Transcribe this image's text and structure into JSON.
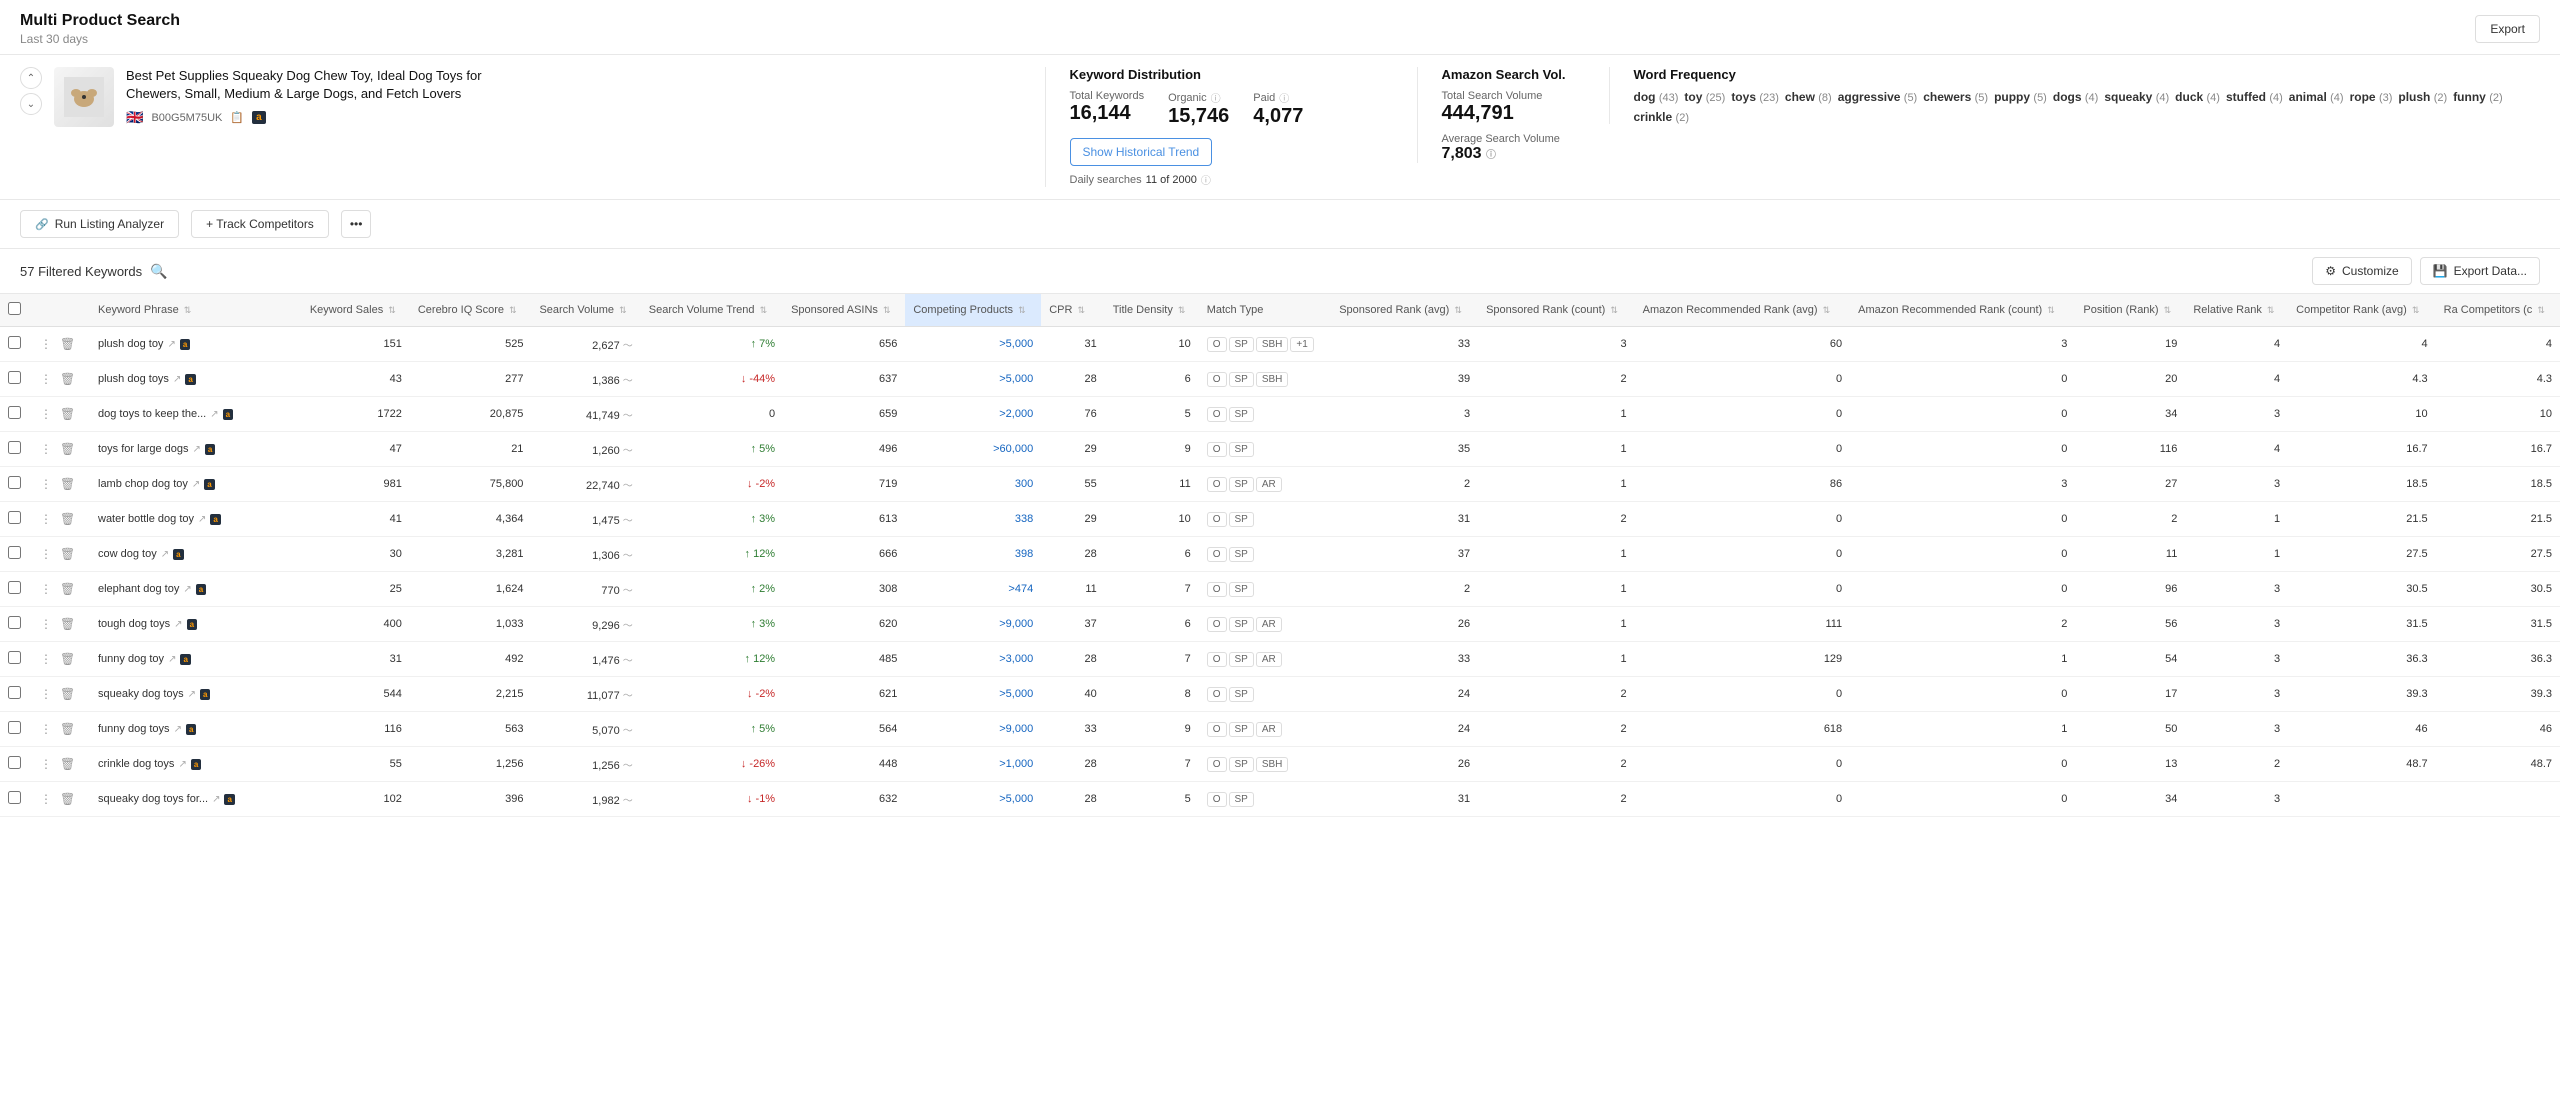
{
  "header": {
    "title": "Multi Product Search",
    "subtitle": "Last 30 days",
    "export_label": "Export"
  },
  "product": {
    "title": "Best Pet Supplies Squeaky Dog Chew Toy, Ideal Dog Toys for Chewers, Small, Medium & Large Dogs, and Fetch Lovers",
    "flag": "🇬🇧",
    "asin": "B00G5M75UK",
    "amazon_badge": "a"
  },
  "keyword_distribution": {
    "title": "Keyword Distribution",
    "total_keywords_label": "Total Keywords",
    "total_keywords_value": "16,144",
    "organic_label": "Organic",
    "organic_value": "15,746",
    "paid_label": "Paid",
    "paid_value": "4,077",
    "show_trend_label": "Show Historical Trend",
    "daily_searches_label": "Daily searches",
    "daily_searches_value": "11 of 2000"
  },
  "amazon_vol": {
    "title": "Amazon Search Vol.",
    "total_label": "Total Search Volume",
    "total_value": "444,791",
    "avg_label": "Average Search Volume",
    "avg_value": "7,803"
  },
  "word_frequency": {
    "title": "Word Frequency",
    "words": [
      {
        "word": "dog",
        "count": 43
      },
      {
        "word": "toy",
        "count": 25
      },
      {
        "word": "toys",
        "count": 23
      },
      {
        "word": "chew",
        "count": 8
      },
      {
        "word": "aggressive",
        "count": 5
      },
      {
        "word": "chewers",
        "count": 5
      },
      {
        "word": "puppy",
        "count": 5
      },
      {
        "word": "dogs",
        "count": 4
      },
      {
        "word": "squeaky",
        "count": 4
      },
      {
        "word": "duck",
        "count": 4
      },
      {
        "word": "stuffed",
        "count": 4
      },
      {
        "word": "animal",
        "count": 4
      },
      {
        "word": "rope",
        "count": 3
      },
      {
        "word": "plush",
        "count": 2
      },
      {
        "word": "funny",
        "count": 2
      },
      {
        "word": "crinkle",
        "count": 2
      }
    ]
  },
  "toolbar": {
    "run_listing_label": "Run Listing Analyzer",
    "track_competitors_label": "+ Track Competitors",
    "more_label": "•••",
    "export_label": "Export"
  },
  "filter_bar": {
    "filtered_label": "57 Filtered Keywords",
    "customize_label": "Customize",
    "export_data_label": "Export Data..."
  },
  "table": {
    "columns": [
      {
        "key": "keyword",
        "label": "Keyword Phrase"
      },
      {
        "key": "kw_sales",
        "label": "Keyword Sales"
      },
      {
        "key": "cerebro",
        "label": "Cerebro IQ Score"
      },
      {
        "key": "sv",
        "label": "Search Volume"
      },
      {
        "key": "svt",
        "label": "Search Volume Trend"
      },
      {
        "key": "sponsored",
        "label": "Sponsored ASINs"
      },
      {
        "key": "competing",
        "label": "Competing Products"
      },
      {
        "key": "cpr",
        "label": "CPR"
      },
      {
        "key": "title_density",
        "label": "Title Density"
      },
      {
        "key": "match_type",
        "label": "Match Type"
      },
      {
        "key": "sp_rank_avg",
        "label": "Sponsored Rank (avg)"
      },
      {
        "key": "sp_rank_cnt",
        "label": "Sponsored Rank (count)"
      },
      {
        "key": "amz_rec_avg",
        "label": "Amazon Recommended Rank (avg)"
      },
      {
        "key": "amz_rec_cnt",
        "label": "Amazon Recommended Rank (count)"
      },
      {
        "key": "position",
        "label": "Position (Rank)"
      },
      {
        "key": "relative_rank",
        "label": "Relative Rank"
      },
      {
        "key": "competitor_rank",
        "label": "Competitor Rank (avg)"
      },
      {
        "key": "ra_comp",
        "label": "Ra Competitors (c"
      }
    ],
    "rows": [
      {
        "keyword": "plush dog toy",
        "kw_sales": 151,
        "cerebro": 525,
        "sv": "2,627",
        "svt": "7%",
        "svt_dir": "up",
        "sponsored": 656,
        "competing": ">5,000",
        "cpr": 31,
        "title_density": 10,
        "match": [
          "O",
          "SP",
          "SBH",
          "+1"
        ],
        "sp_rank_avg": 33,
        "sp_rank_cnt": 3,
        "amz_rec_avg": 60,
        "amz_rec_cnt": 3,
        "position": 19,
        "relative_rank": 4,
        "competitor_rank": 4,
        "ra_comp": 4
      },
      {
        "keyword": "plush dog toys",
        "kw_sales": 43,
        "cerebro": 277,
        "sv": "1,386",
        "svt": "-44%",
        "svt_dir": "down",
        "sponsored": 637,
        "competing": ">5,000",
        "cpr": 28,
        "title_density": 6,
        "match": [
          "O",
          "SP",
          "SBH"
        ],
        "sp_rank_avg": 39,
        "sp_rank_cnt": 2,
        "amz_rec_avg": 0,
        "amz_rec_cnt": 0,
        "position": 20,
        "relative_rank": 4,
        "competitor_rank": 4.3,
        "ra_comp": 4.3
      },
      {
        "keyword": "dog toys to keep the...",
        "kw_sales": 1722,
        "cerebro": 20875,
        "sv": "41,749",
        "svt": "0",
        "svt_dir": "neutral",
        "sponsored": 659,
        "competing": ">2,000",
        "cpr": 76,
        "title_density": 5,
        "match": [
          "O",
          "SP"
        ],
        "sp_rank_avg": 3,
        "sp_rank_cnt": 1,
        "amz_rec_avg": 0,
        "amz_rec_cnt": 0,
        "position": 34,
        "relative_rank": 3,
        "competitor_rank": 10,
        "ra_comp": 10
      },
      {
        "keyword": "toys for large dogs",
        "kw_sales": 47,
        "cerebro": 21,
        "sv": "1,260",
        "svt": "5%",
        "svt_dir": "up",
        "sponsored": 496,
        "competing": ">60,000",
        "cpr": 29,
        "title_density": 9,
        "match": [
          "O",
          "SP"
        ],
        "sp_rank_avg": 35,
        "sp_rank_cnt": 1,
        "amz_rec_avg": 0,
        "amz_rec_cnt": 0,
        "position": 116,
        "relative_rank": 4,
        "competitor_rank": 16.7,
        "ra_comp": 16.7
      },
      {
        "keyword": "lamb chop dog toy",
        "kw_sales": 981,
        "cerebro": 75800,
        "sv": "22,740",
        "svt": "-2%",
        "svt_dir": "down",
        "sponsored": 719,
        "competing": "300",
        "cpr": 55,
        "title_density": 11,
        "match": [
          "O",
          "SP",
          "AR"
        ],
        "sp_rank_avg": 2,
        "sp_rank_cnt": 1,
        "amz_rec_avg": 86,
        "amz_rec_cnt": 3,
        "position": 27,
        "relative_rank": 3,
        "competitor_rank": 18.5,
        "ra_comp": 18.5
      },
      {
        "keyword": "water bottle dog toy",
        "kw_sales": 41,
        "cerebro": 4364,
        "sv": "1,475",
        "svt": "3%",
        "svt_dir": "up",
        "sponsored": 613,
        "competing": "338",
        "cpr": 29,
        "title_density": 10,
        "match": [
          "O",
          "SP"
        ],
        "sp_rank_avg": 31,
        "sp_rank_cnt": 2,
        "amz_rec_avg": 0,
        "amz_rec_cnt": 0,
        "position": 2,
        "relative_rank": 1,
        "competitor_rank": 21.5,
        "ra_comp": 21.5
      },
      {
        "keyword": "cow dog toy",
        "kw_sales": 30,
        "cerebro": 3281,
        "sv": "1,306",
        "svt": "12%",
        "svt_dir": "up",
        "sponsored": 666,
        "competing": "398",
        "cpr": 28,
        "title_density": 6,
        "match": [
          "O",
          "SP"
        ],
        "sp_rank_avg": 37,
        "sp_rank_cnt": 1,
        "amz_rec_avg": 0,
        "amz_rec_cnt": 0,
        "position": 11,
        "relative_rank": 1,
        "competitor_rank": 27.5,
        "ra_comp": 27.5
      },
      {
        "keyword": "elephant dog toy",
        "kw_sales": 25,
        "cerebro": 1624,
        "sv": "770",
        "svt": "2%",
        "svt_dir": "up",
        "sponsored": 308,
        "competing": ">474",
        "cpr": 11,
        "title_density": 7,
        "match": [
          "O",
          "SP"
        ],
        "sp_rank_avg": 2,
        "sp_rank_cnt": 1,
        "amz_rec_avg": 0,
        "amz_rec_cnt": 0,
        "position": 96,
        "relative_rank": 3,
        "competitor_rank": 30.5,
        "ra_comp": 30.5
      },
      {
        "keyword": "tough dog toys",
        "kw_sales": 400,
        "cerebro": 1033,
        "sv": "9,296",
        "svt": "3%",
        "svt_dir": "up",
        "sponsored": 620,
        "competing": ">9,000",
        "cpr": 37,
        "title_density": 6,
        "match": [
          "O",
          "SP",
          "AR"
        ],
        "sp_rank_avg": 26,
        "sp_rank_cnt": 1,
        "amz_rec_avg": 111,
        "amz_rec_cnt": 2,
        "position": 56,
        "relative_rank": 3,
        "competitor_rank": 31.5,
        "ra_comp": 31.5
      },
      {
        "keyword": "funny dog toy",
        "kw_sales": 31,
        "cerebro": 492,
        "sv": "1,476",
        "svt": "12%",
        "svt_dir": "up",
        "sponsored": 485,
        "competing": ">3,000",
        "cpr": 28,
        "title_density": 7,
        "match": [
          "O",
          "SP",
          "AR"
        ],
        "sp_rank_avg": 33,
        "sp_rank_cnt": 1,
        "amz_rec_avg": 129,
        "amz_rec_cnt": 1,
        "position": 54,
        "relative_rank": 3,
        "competitor_rank": 36.3,
        "ra_comp": 36.3
      },
      {
        "keyword": "squeaky dog toys",
        "kw_sales": 544,
        "cerebro": 2215,
        "sv": "11,077",
        "svt": "-2%",
        "svt_dir": "down",
        "sponsored": 621,
        "competing": ">5,000",
        "cpr": 40,
        "title_density": 8,
        "match": [
          "O",
          "SP"
        ],
        "sp_rank_avg": 24,
        "sp_rank_cnt": 2,
        "amz_rec_avg": 0,
        "amz_rec_cnt": 0,
        "position": 17,
        "relative_rank": 3,
        "competitor_rank": 39.3,
        "ra_comp": 39.3
      },
      {
        "keyword": "funny dog toys",
        "kw_sales": 116,
        "cerebro": 563,
        "sv": "5,070",
        "svt": "5%",
        "svt_dir": "up",
        "sponsored": 564,
        "competing": ">9,000",
        "cpr": 33,
        "title_density": 9,
        "match": [
          "O",
          "SP",
          "AR"
        ],
        "sp_rank_avg": 24,
        "sp_rank_cnt": 2,
        "amz_rec_avg": 618,
        "amz_rec_cnt": 1,
        "position": 50,
        "relative_rank": 3,
        "competitor_rank": 46,
        "ra_comp": 46
      },
      {
        "keyword": "crinkle dog toys",
        "kw_sales": 55,
        "cerebro": 1256,
        "sv": "1,256",
        "svt": "-26%",
        "svt_dir": "down",
        "sponsored": 448,
        "competing": ">1,000",
        "cpr": 28,
        "title_density": 7,
        "match": [
          "O",
          "SP",
          "SBH"
        ],
        "sp_rank_avg": 26,
        "sp_rank_cnt": 2,
        "amz_rec_avg": 0,
        "amz_rec_cnt": 0,
        "position": 13,
        "relative_rank": 2,
        "competitor_rank": 48.7,
        "ra_comp": 48.7
      },
      {
        "keyword": "squeaky dog toys for...",
        "kw_sales": 102,
        "cerebro": 396,
        "sv": "1,982",
        "svt": "-1%",
        "svt_dir": "down",
        "sponsored": 632,
        "competing": ">5,000",
        "cpr": 28,
        "title_density": 5,
        "match": [
          "O",
          "SP"
        ],
        "sp_rank_avg": 31,
        "sp_rank_cnt": 2,
        "amz_rec_avg": 0,
        "amz_rec_cnt": 0,
        "position": 34,
        "relative_rank": 3,
        "competitor_rank": "",
        "ra_comp": ""
      }
    ]
  }
}
